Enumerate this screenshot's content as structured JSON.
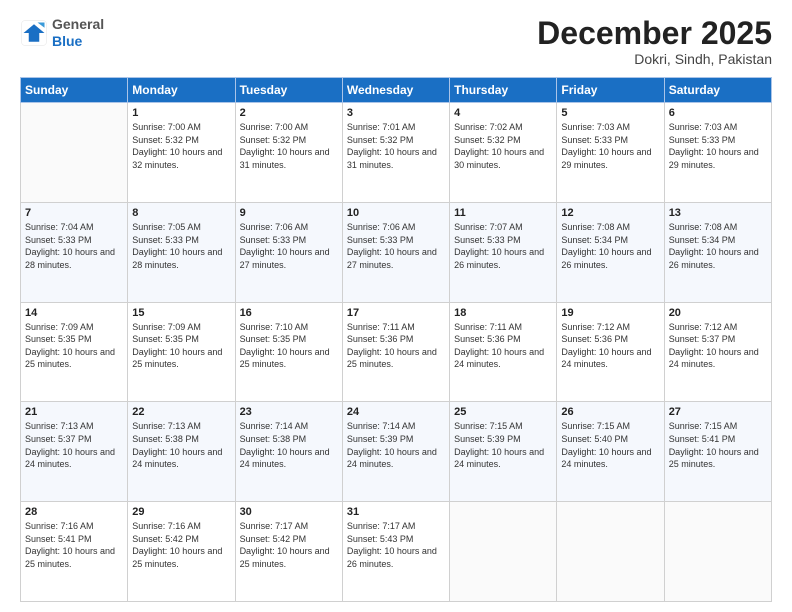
{
  "header": {
    "logo": {
      "general": "General",
      "blue": "Blue"
    },
    "month": "December 2025",
    "location": "Dokri, Sindh, Pakistan"
  },
  "weekdays": [
    "Sunday",
    "Monday",
    "Tuesday",
    "Wednesday",
    "Thursday",
    "Friday",
    "Saturday"
  ],
  "weeks": [
    [
      {
        "day": "",
        "sunrise": "",
        "sunset": "",
        "daylight": ""
      },
      {
        "day": "1",
        "sunrise": "Sunrise: 7:00 AM",
        "sunset": "Sunset: 5:32 PM",
        "daylight": "Daylight: 10 hours and 32 minutes."
      },
      {
        "day": "2",
        "sunrise": "Sunrise: 7:00 AM",
        "sunset": "Sunset: 5:32 PM",
        "daylight": "Daylight: 10 hours and 31 minutes."
      },
      {
        "day": "3",
        "sunrise": "Sunrise: 7:01 AM",
        "sunset": "Sunset: 5:32 PM",
        "daylight": "Daylight: 10 hours and 31 minutes."
      },
      {
        "day": "4",
        "sunrise": "Sunrise: 7:02 AM",
        "sunset": "Sunset: 5:32 PM",
        "daylight": "Daylight: 10 hours and 30 minutes."
      },
      {
        "day": "5",
        "sunrise": "Sunrise: 7:03 AM",
        "sunset": "Sunset: 5:33 PM",
        "daylight": "Daylight: 10 hours and 29 minutes."
      },
      {
        "day": "6",
        "sunrise": "Sunrise: 7:03 AM",
        "sunset": "Sunset: 5:33 PM",
        "daylight": "Daylight: 10 hours and 29 minutes."
      }
    ],
    [
      {
        "day": "7",
        "sunrise": "Sunrise: 7:04 AM",
        "sunset": "Sunset: 5:33 PM",
        "daylight": "Daylight: 10 hours and 28 minutes."
      },
      {
        "day": "8",
        "sunrise": "Sunrise: 7:05 AM",
        "sunset": "Sunset: 5:33 PM",
        "daylight": "Daylight: 10 hours and 28 minutes."
      },
      {
        "day": "9",
        "sunrise": "Sunrise: 7:06 AM",
        "sunset": "Sunset: 5:33 PM",
        "daylight": "Daylight: 10 hours and 27 minutes."
      },
      {
        "day": "10",
        "sunrise": "Sunrise: 7:06 AM",
        "sunset": "Sunset: 5:33 PM",
        "daylight": "Daylight: 10 hours and 27 minutes."
      },
      {
        "day": "11",
        "sunrise": "Sunrise: 7:07 AM",
        "sunset": "Sunset: 5:33 PM",
        "daylight": "Daylight: 10 hours and 26 minutes."
      },
      {
        "day": "12",
        "sunrise": "Sunrise: 7:08 AM",
        "sunset": "Sunset: 5:34 PM",
        "daylight": "Daylight: 10 hours and 26 minutes."
      },
      {
        "day": "13",
        "sunrise": "Sunrise: 7:08 AM",
        "sunset": "Sunset: 5:34 PM",
        "daylight": "Daylight: 10 hours and 26 minutes."
      }
    ],
    [
      {
        "day": "14",
        "sunrise": "Sunrise: 7:09 AM",
        "sunset": "Sunset: 5:35 PM",
        "daylight": "Daylight: 10 hours and 25 minutes."
      },
      {
        "day": "15",
        "sunrise": "Sunrise: 7:09 AM",
        "sunset": "Sunset: 5:35 PM",
        "daylight": "Daylight: 10 hours and 25 minutes."
      },
      {
        "day": "16",
        "sunrise": "Sunrise: 7:10 AM",
        "sunset": "Sunset: 5:35 PM",
        "daylight": "Daylight: 10 hours and 25 minutes."
      },
      {
        "day": "17",
        "sunrise": "Sunrise: 7:11 AM",
        "sunset": "Sunset: 5:36 PM",
        "daylight": "Daylight: 10 hours and 25 minutes."
      },
      {
        "day": "18",
        "sunrise": "Sunrise: 7:11 AM",
        "sunset": "Sunset: 5:36 PM",
        "daylight": "Daylight: 10 hours and 24 minutes."
      },
      {
        "day": "19",
        "sunrise": "Sunrise: 7:12 AM",
        "sunset": "Sunset: 5:36 PM",
        "daylight": "Daylight: 10 hours and 24 minutes."
      },
      {
        "day": "20",
        "sunrise": "Sunrise: 7:12 AM",
        "sunset": "Sunset: 5:37 PM",
        "daylight": "Daylight: 10 hours and 24 minutes."
      }
    ],
    [
      {
        "day": "21",
        "sunrise": "Sunrise: 7:13 AM",
        "sunset": "Sunset: 5:37 PM",
        "daylight": "Daylight: 10 hours and 24 minutes."
      },
      {
        "day": "22",
        "sunrise": "Sunrise: 7:13 AM",
        "sunset": "Sunset: 5:38 PM",
        "daylight": "Daylight: 10 hours and 24 minutes."
      },
      {
        "day": "23",
        "sunrise": "Sunrise: 7:14 AM",
        "sunset": "Sunset: 5:38 PM",
        "daylight": "Daylight: 10 hours and 24 minutes."
      },
      {
        "day": "24",
        "sunrise": "Sunrise: 7:14 AM",
        "sunset": "Sunset: 5:39 PM",
        "daylight": "Daylight: 10 hours and 24 minutes."
      },
      {
        "day": "25",
        "sunrise": "Sunrise: 7:15 AM",
        "sunset": "Sunset: 5:39 PM",
        "daylight": "Daylight: 10 hours and 24 minutes."
      },
      {
        "day": "26",
        "sunrise": "Sunrise: 7:15 AM",
        "sunset": "Sunset: 5:40 PM",
        "daylight": "Daylight: 10 hours and 24 minutes."
      },
      {
        "day": "27",
        "sunrise": "Sunrise: 7:15 AM",
        "sunset": "Sunset: 5:41 PM",
        "daylight": "Daylight: 10 hours and 25 minutes."
      }
    ],
    [
      {
        "day": "28",
        "sunrise": "Sunrise: 7:16 AM",
        "sunset": "Sunset: 5:41 PM",
        "daylight": "Daylight: 10 hours and 25 minutes."
      },
      {
        "day": "29",
        "sunrise": "Sunrise: 7:16 AM",
        "sunset": "Sunset: 5:42 PM",
        "daylight": "Daylight: 10 hours and 25 minutes."
      },
      {
        "day": "30",
        "sunrise": "Sunrise: 7:17 AM",
        "sunset": "Sunset: 5:42 PM",
        "daylight": "Daylight: 10 hours and 25 minutes."
      },
      {
        "day": "31",
        "sunrise": "Sunrise: 7:17 AM",
        "sunset": "Sunset: 5:43 PM",
        "daylight": "Daylight: 10 hours and 26 minutes."
      },
      {
        "day": "",
        "sunrise": "",
        "sunset": "",
        "daylight": ""
      },
      {
        "day": "",
        "sunrise": "",
        "sunset": "",
        "daylight": ""
      },
      {
        "day": "",
        "sunrise": "",
        "sunset": "",
        "daylight": ""
      }
    ]
  ]
}
